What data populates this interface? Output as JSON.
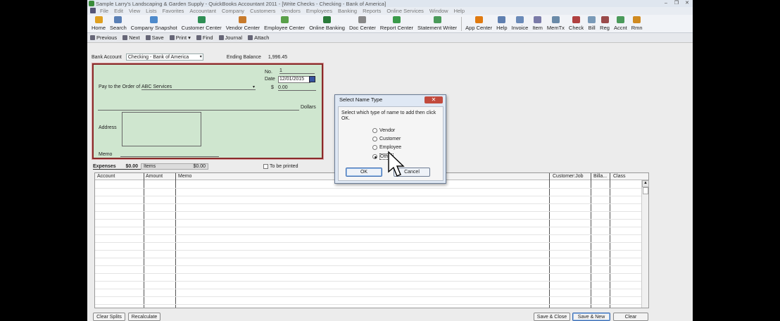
{
  "window": {
    "title": "Sample Larry's Landscaping & Garden Supply - QuickBooks Accountant 2011 - [Write Checks - Checking - Bank of America]"
  },
  "menu": [
    "File",
    "Edit",
    "View",
    "Lists",
    "Favorites",
    "Accountant",
    "Company",
    "Customers",
    "Vendors",
    "Employees",
    "Banking",
    "Reports",
    "Online Services",
    "Window",
    "Help"
  ],
  "iconbar": {
    "left": [
      {
        "label": "Home",
        "icon": "home-icon",
        "color": "#e0a020"
      },
      {
        "label": "Search",
        "icon": "search-icon",
        "color": "#5a7fb5"
      },
      {
        "label": "Company Snapshot",
        "icon": "snapshot-icon",
        "color": "#4e8acb"
      },
      {
        "label": "Customer Center",
        "icon": "customer-icon",
        "color": "#2f8f55"
      },
      {
        "label": "Vendor Center",
        "icon": "vendor-icon",
        "color": "#c77a2b"
      },
      {
        "label": "Employee Center",
        "icon": "employee-icon",
        "color": "#5aa04a"
      },
      {
        "label": "Online Banking",
        "icon": "online-banking-icon",
        "color": "#2a7a3a"
      },
      {
        "label": "Doc Center",
        "icon": "doc-icon",
        "color": "#888888"
      },
      {
        "label": "Report Center",
        "icon": "report-icon",
        "color": "#3a9a4a"
      },
      {
        "label": "Statement Writer",
        "icon": "statement-icon",
        "color": "#4a9a5a"
      }
    ],
    "right": [
      {
        "label": "App Center",
        "icon": "app-center-icon",
        "color": "#e07a10"
      },
      {
        "label": "Help",
        "icon": "help-icon",
        "color": "#5f7fb0"
      },
      {
        "label": "Invoice",
        "icon": "invoice-icon",
        "color": "#6a8ab8"
      },
      {
        "label": "Item",
        "icon": "item-icon",
        "color": "#7a7aa8"
      },
      {
        "label": "MemTx",
        "icon": "memtx-icon",
        "color": "#6a8aa8"
      },
      {
        "label": "Check",
        "icon": "check-icon",
        "color": "#b04040"
      },
      {
        "label": "Bill",
        "icon": "bill-icon",
        "color": "#7a9ab8"
      },
      {
        "label": "Reg",
        "icon": "register-icon",
        "color": "#9a4a4a"
      },
      {
        "label": "Accnt",
        "icon": "account-icon",
        "color": "#4a9a5a"
      },
      {
        "label": "Rmn",
        "icon": "reminder-icon",
        "color": "#d08a20"
      }
    ]
  },
  "toolbar": {
    "previous": "Previous",
    "next": "Next",
    "save": "Save",
    "print": "Print",
    "find": "Find",
    "journal": "Journal",
    "attach": "Attach"
  },
  "account": {
    "label": "Bank Account",
    "value": "Checking - Bank of America",
    "ending_label": "Ending Balance",
    "ending_value": "1,996.45"
  },
  "check": {
    "no_label": "No.",
    "no_value": "1",
    "date_label": "Date",
    "date_value": "12/01/2015",
    "amount_label": "$",
    "amount_value": "0.00",
    "pay_label": "Pay to the Order of",
    "pay_value": "ABC Services",
    "dollars_label": "Dollars",
    "address_label": "Address",
    "memo_label": "Memo"
  },
  "expenses": {
    "tab": "Expenses",
    "tab_amount": "$0.00",
    "items_tab": "Items",
    "items_amount": "$0.00",
    "to_be_printed": "To be printed"
  },
  "grid": {
    "headers": [
      "Account",
      "Amount",
      "Memo",
      "Customer:Job",
      "Billa...",
      "Class"
    ]
  },
  "buttons": {
    "clear_splits": "Clear Splits",
    "recalculate": "Recalculate",
    "save_close": "Save & Close",
    "save_new": "Save & New",
    "clear": "Clear"
  },
  "dialog": {
    "title": "Select Name Type",
    "prompt": "Select which type of name to add then click OK.",
    "options": [
      "Vendor",
      "Customer",
      "Employee",
      "Other"
    ],
    "selected": "Other",
    "ok": "OK",
    "cancel": "Cancel"
  }
}
